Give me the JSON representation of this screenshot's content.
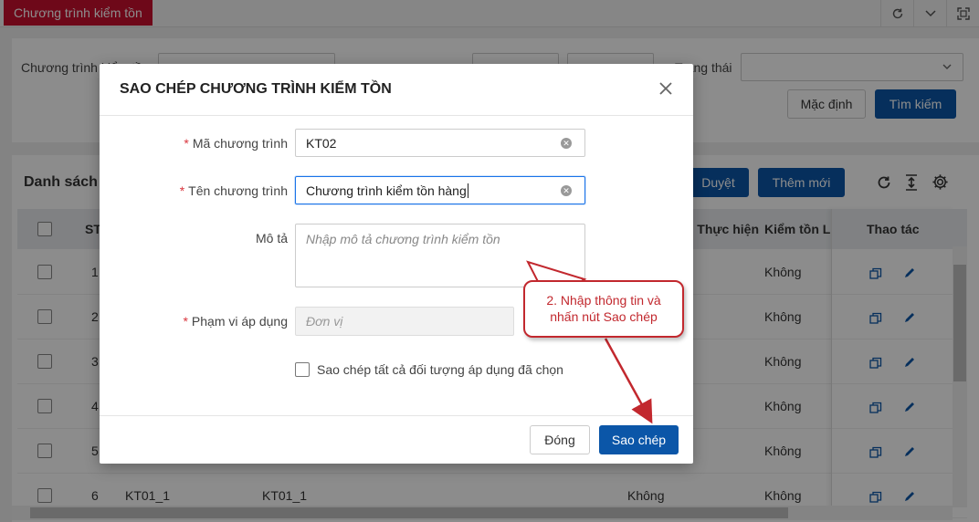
{
  "top_tab": {
    "label": "Chương trình kiểm tồn"
  },
  "filter": {
    "program_label": "Chương trình kiểm tồn",
    "status_label": "Trạng thái",
    "default_button": "Mặc định",
    "search_button": "Tìm kiếm"
  },
  "list": {
    "title": "Danh sách",
    "approve_button": "Duyệt",
    "add_button": "Thêm mới",
    "columns": {
      "stt": "STT",
      "executing": "Thực hiện",
      "inventory": "Kiểm tồn L",
      "actions": "Thao tác"
    },
    "rows": [
      {
        "stt": "1",
        "code": "",
        "name": "",
        "exec": "",
        "inv": "Không"
      },
      {
        "stt": "2",
        "code": "",
        "name": "",
        "exec": "",
        "inv": "Không"
      },
      {
        "stt": "3",
        "code": "",
        "name": "",
        "exec": "",
        "inv": "Không"
      },
      {
        "stt": "4",
        "code": "",
        "name": "",
        "exec": "",
        "inv": "Không"
      },
      {
        "stt": "5",
        "code": "",
        "name": "",
        "exec": "",
        "inv": "Không"
      },
      {
        "stt": "6",
        "code": "KT01_1",
        "name": "KT01_1",
        "exec": "Không",
        "inv": "Không"
      }
    ]
  },
  "modal": {
    "title": "SAO CHÉP CHƯƠNG TRÌNH KIỂM TỒN",
    "code_label": "Mã chương trình",
    "code_value": "KT02",
    "name_label": "Tên chương trình",
    "name_value": "Chương trình kiểm tồn hàng",
    "desc_label": "Mô tả",
    "desc_placeholder": "Nhập mô tả chương trình kiểm tồn",
    "scope_label": "Phạm vi áp dụng",
    "scope_value": "Đơn vị",
    "copy_all_label": "Sao chép tất cả đối tượng áp dụng đã chọn",
    "close_button": "Đóng",
    "copy_button": "Sao chép",
    "required_mark": "*"
  },
  "callout": {
    "line1": "2. Nhập thông tin và",
    "line2": "nhấn nút Sao chép"
  },
  "colors": {
    "brand_red": "#c8102e",
    "primary_blue": "#0b56a8",
    "annotation_red": "#c2282e"
  }
}
